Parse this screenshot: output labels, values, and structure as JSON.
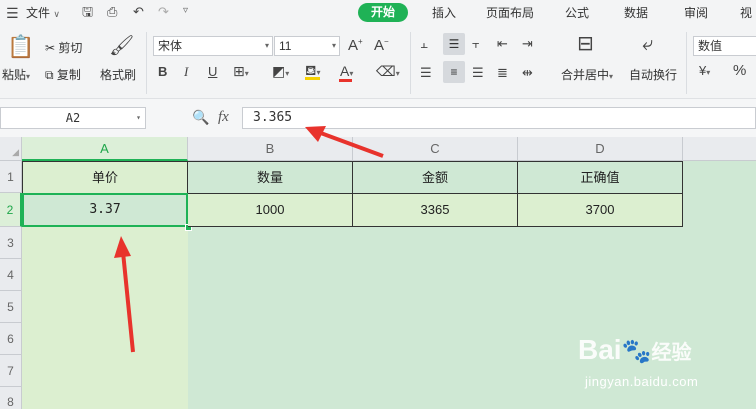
{
  "menu": {
    "file_label": "文件",
    "tabs": [
      "开始",
      "插入",
      "页面布局",
      "公式",
      "数据",
      "审阅",
      "视"
    ]
  },
  "ribbon": {
    "paste_label": "粘贴",
    "cut_label": "剪切",
    "copy_label": "复制",
    "format_painter_label": "格式刷",
    "font_name": "宋体",
    "font_size": "11",
    "merge_center_label": "合并居中",
    "wrap_text_label": "自动换行",
    "number_format": "数值",
    "percent_symbol": "%",
    "font_color": "#e8332c",
    "fill_color": "#f5d000"
  },
  "formula_bar": {
    "name_box": "A2",
    "fx_label": "fx",
    "formula_value": "3.365"
  },
  "sheet": {
    "columns": [
      "A",
      "B",
      "C",
      "D"
    ],
    "rows": [
      "1",
      "2",
      "3",
      "4",
      "5",
      "6",
      "7",
      "8"
    ],
    "header_cells": [
      "单价",
      "数量",
      "金额",
      "正确值"
    ],
    "data_cells": [
      "3.37",
      "1000",
      "3365",
      "3700"
    ],
    "selected_cell": "A2",
    "accent_color": "#1fb256"
  },
  "watermark": {
    "brand": "Bai",
    "brand_suffix": "经验",
    "url": "jingyan.baidu.com"
  }
}
